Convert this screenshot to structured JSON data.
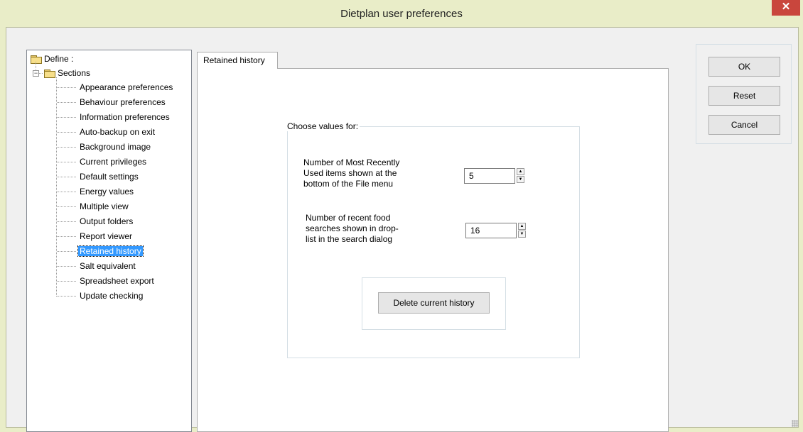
{
  "window": {
    "title": "Dietplan user preferences",
    "close_glyph": "✕"
  },
  "tree": {
    "root_label": "Define :",
    "root_icon": "folder-open-icon",
    "sections_label": "Sections",
    "sections_icon": "folder-open-icon",
    "expander_glyph": "−",
    "items": [
      {
        "label": "Appearance preferences"
      },
      {
        "label": "Behaviour preferences"
      },
      {
        "label": "Information preferences"
      },
      {
        "label": "Auto-backup on exit"
      },
      {
        "label": "Background image"
      },
      {
        "label": "Current privileges"
      },
      {
        "label": "Default settings"
      },
      {
        "label": "Energy values"
      },
      {
        "label": "Multiple view"
      },
      {
        "label": "Output folders"
      },
      {
        "label": "Report viewer"
      },
      {
        "label": "Retained history",
        "selected": true
      },
      {
        "label": "Salt equivalent"
      },
      {
        "label": "Spreadsheet export"
      },
      {
        "label": "Update checking"
      }
    ]
  },
  "tab": {
    "label": "Retained history",
    "group_label": "Choose values for:",
    "mru_label": "Number of Most Recently\nUsed items shown at the\nbottom of the File menu",
    "mru_value": "5",
    "food_label": "Number of recent food\nsearches shown in drop-\nlist in the search dialog",
    "food_value": "16",
    "spin_up": "▲",
    "spin_down": "▼",
    "delete_button": "Delete current history"
  },
  "buttons": {
    "ok": "OK",
    "reset": "Reset",
    "cancel": "Cancel"
  }
}
